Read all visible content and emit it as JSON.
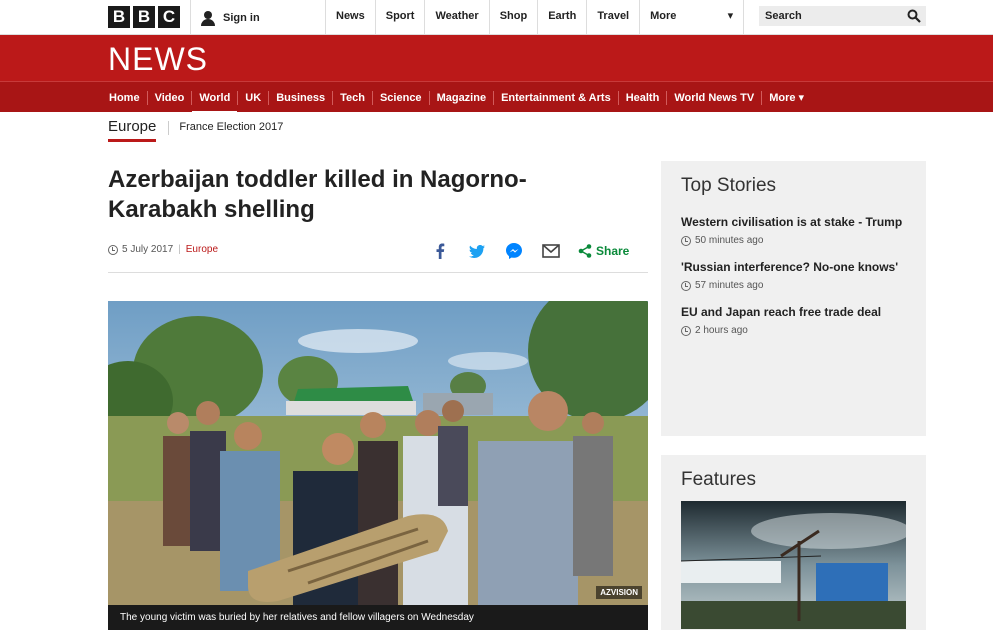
{
  "topbar": {
    "logo_letters": [
      "B",
      "B",
      "C"
    ],
    "signin_label": "Sign in",
    "nav": [
      "News",
      "Sport",
      "Weather",
      "Shop",
      "Earth",
      "Travel"
    ],
    "more_label": "More",
    "more_arrow": "▾",
    "search_placeholder": "Search"
  },
  "newsband": {
    "logo": "NEWS",
    "nav": [
      "Home",
      "Video",
      "World",
      "UK",
      "Business",
      "Tech",
      "Science",
      "Magazine",
      "Entertainment & Arts",
      "Health",
      "World News TV",
      "More ▾"
    ],
    "active": "World"
  },
  "subnav": {
    "section": "Europe",
    "item": "France Election 2017"
  },
  "article": {
    "headline": "Azerbaijan toddler killed in Nagorno-Karabakh shelling",
    "date": "5 July 2017",
    "category": "Europe",
    "share_label": "Share",
    "photo_credit": "AZVISION",
    "caption": "The young victim was buried by her relatives and fellow villagers on Wednesday"
  },
  "sidebar": {
    "top_stories_title": "Top Stories",
    "stories": [
      {
        "title": "Western civilisation is at stake - Trump",
        "time": "50 minutes ago"
      },
      {
        "title": "'Russian interference? No-one knows'",
        "time": "57 minutes ago"
      },
      {
        "title": "EU and Japan reach free trade deal",
        "time": "2 hours ago"
      }
    ],
    "features_title": "Features"
  },
  "colors": {
    "brand_red": "#bb1919",
    "share_green": "#0a8a3a"
  }
}
